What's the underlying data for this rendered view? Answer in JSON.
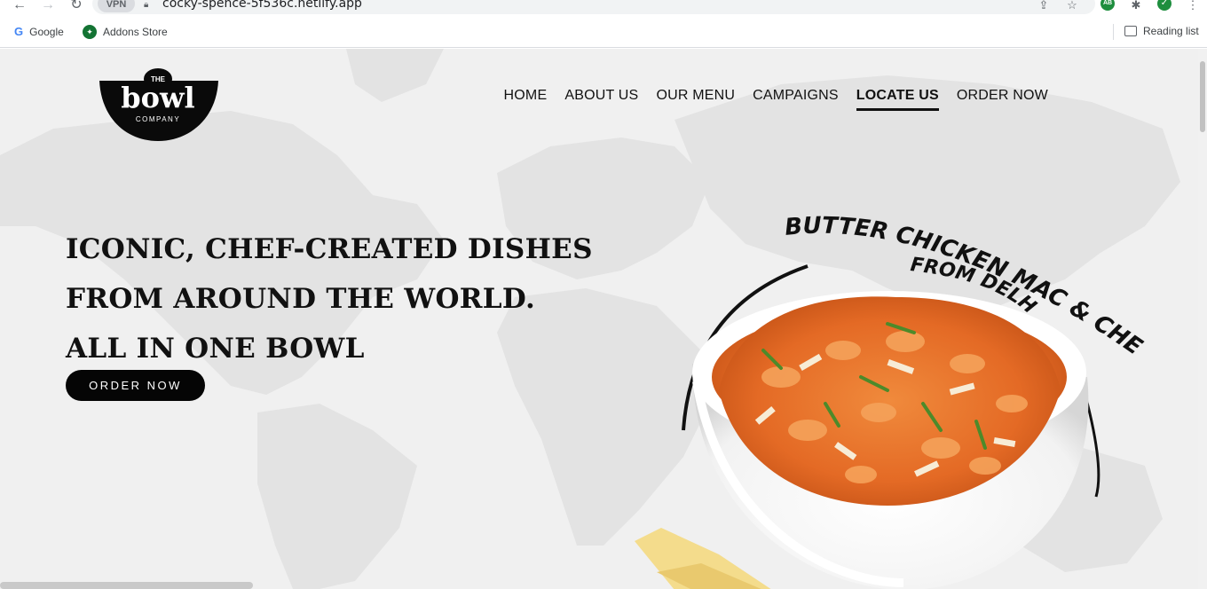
{
  "browser": {
    "url": "cocky-spence-5f536c.netlify.app",
    "vpn_label": "VPN",
    "bookmarks": [
      {
        "label": "Google",
        "icon": "google-icon"
      },
      {
        "label": "Addons Store",
        "icon": "addons-store-icon"
      }
    ],
    "reading_list_label": "Reading list"
  },
  "site": {
    "logo": {
      "top": "THE",
      "main": "bowl",
      "bottom": "COMPANY"
    },
    "nav": [
      {
        "label": "HOME",
        "active": false
      },
      {
        "label": "ABOUT US",
        "active": false
      },
      {
        "label": "OUR MENU",
        "active": false
      },
      {
        "label": "CAMPAIGNS",
        "active": false
      },
      {
        "label": "LOCATE US",
        "active": true
      },
      {
        "label": "ORDER NOW",
        "active": false
      }
    ],
    "hero": {
      "lines": [
        "ICONIC, CHEF-CREATED DISHES",
        "FROM AROUND THE WORLD.",
        "ALL IN ONE BOWL"
      ],
      "cta": "ORDER NOW"
    },
    "dish": {
      "caption_line1": "BUTTER CHICKEN MAC & CHEESE",
      "caption_line2": "FROM DELHI"
    }
  },
  "colors": {
    "background": "#f0f0f0",
    "map": "#e2e2e2",
    "text": "#111111",
    "button": "#050505"
  }
}
